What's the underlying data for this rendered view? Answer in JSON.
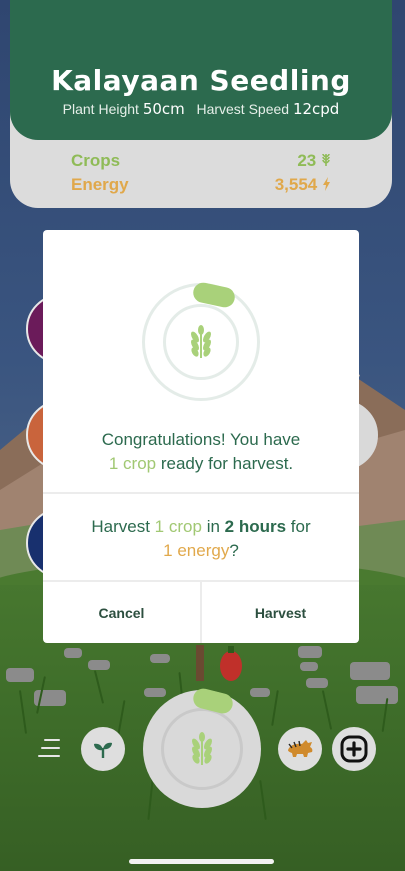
{
  "header": {
    "title": "Kalayaan Seedling",
    "plant_height_label": "Plant Height",
    "plant_height_value": "50cm",
    "harvest_speed_label": "Harvest Speed",
    "harvest_speed_value": "12cpd"
  },
  "stats": {
    "crops_label": "Crops",
    "crops_value": "23",
    "crops_icon": "wheat-icon",
    "energy_label": "Energy",
    "energy_value": "3,554",
    "energy_icon": "lightning-icon"
  },
  "dialog": {
    "congrats_line1": "Congratulations! You have",
    "crop_count": "1",
    "crop_word": "crop",
    "ready_text": "ready for harvest.",
    "q_harvest": "Harvest",
    "q_count": "1",
    "q_crop_word": "crop",
    "q_in": "in",
    "q_duration": "2 hours",
    "q_for": "for",
    "q_energy": "1 energy",
    "q_mark": "?",
    "cancel_label": "Cancel",
    "harvest_label": "Harvest",
    "progress_fraction": 0.1
  },
  "toolbar": {
    "menu_icon": "hamburger-menu-icon",
    "plant_icon": "sprout-icon",
    "center_icon": "wheat-icon",
    "animal_icon": "tamaraw-icon",
    "add_icon": "plus-icon"
  },
  "colors": {
    "brand_green": "#2c6a4e",
    "crop_green": "#a1c873",
    "energy_orange": "#e1a94c",
    "card_gray": "#dcdcdc"
  }
}
